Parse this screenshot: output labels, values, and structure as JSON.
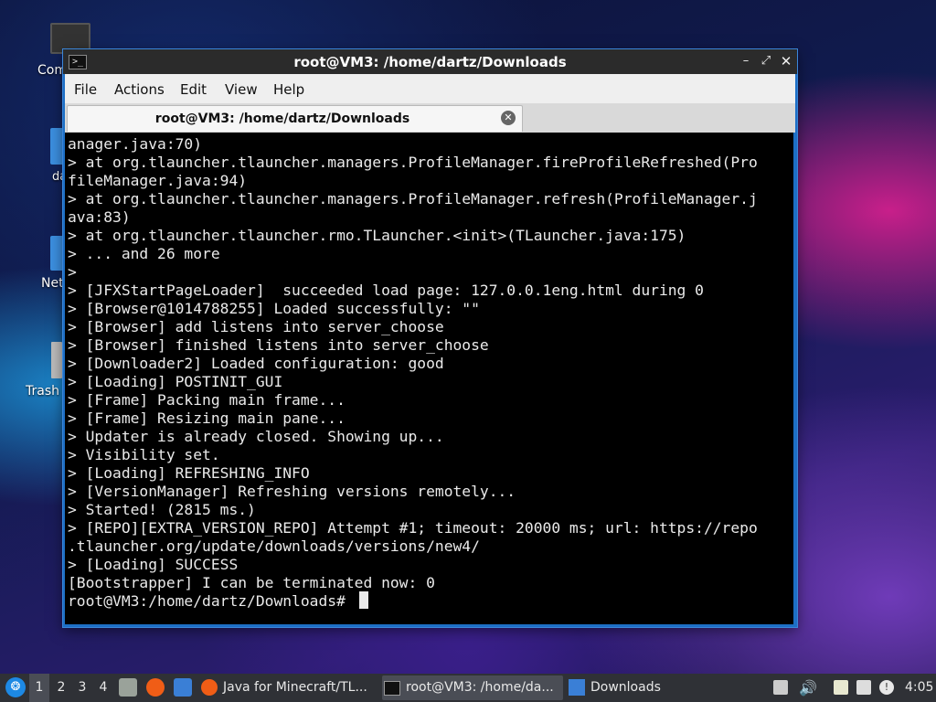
{
  "desktop": {
    "icons": [
      {
        "label": "Com"
      },
      {
        "label": "da"
      },
      {
        "label": "Net"
      },
      {
        "label": "Trash"
      }
    ]
  },
  "window": {
    "title": "root@VM3: /home/dartz/Downloads",
    "icon_glyph": ">_",
    "controls": {
      "minimize": "–",
      "maximize": "⤢",
      "close": "✕"
    },
    "menu": [
      "File",
      "Actions",
      "Edit",
      "View",
      "Help"
    ],
    "tab": {
      "label": "root@VM3: /home/dartz/Downloads",
      "close_glyph": "✕"
    }
  },
  "terminal": {
    "text": "anager.java:70)\n> at org.tlauncher.tlauncher.managers.ProfileManager.fireProfileRefreshed(Pro\nfileManager.java:94)\n> at org.tlauncher.tlauncher.managers.ProfileManager.refresh(ProfileManager.j\nava:83)\n> at org.tlauncher.tlauncher.rmo.TLauncher.<init>(TLauncher.java:175)\n> ... and 26 more\n>\n> [JFXStartPageLoader]  succeeded load page: 127.0.0.1eng.html during 0\n> [Browser@1014788255] Loaded successfully: \"\"\n> [Browser] add listens into server_choose\n> [Browser] finished listens into server_choose\n> [Downloader2] Loaded configuration: good\n> [Loading] POSTINIT_GUI\n> [Frame] Packing main frame...\n> [Frame] Resizing main pane...\n> Updater is already closed. Showing up...\n> Visibility set.\n> [Loading] REFRESHING_INFO\n> [VersionManager] Refreshing versions remotely...\n> Started! (2815 ms.)\n> [REPO][EXTRA_VERSION_REPO] Attempt #1; timeout: 20000 ms; url: https://repo\n.tlauncher.org/update/downloads/versions/new4/\n> [Loading] SUCCESS\n[Bootstrapper] I can be terminated now: 0\nroot@VM3:/home/dartz/Downloads# "
  },
  "taskbar": {
    "start_glyph": "❂",
    "workspaces": [
      "1",
      "2",
      "3",
      "4"
    ],
    "tasks": [
      {
        "label": "Java for Minecraft/TL...",
        "icon": "firefox-icon"
      },
      {
        "label": "root@VM3: /home/da...",
        "icon": "terminal-icon"
      },
      {
        "label": "Downloads",
        "icon": "folder-icon"
      }
    ],
    "volume_glyph": "🔊",
    "notify_glyph": "!",
    "clock": "4:05"
  }
}
